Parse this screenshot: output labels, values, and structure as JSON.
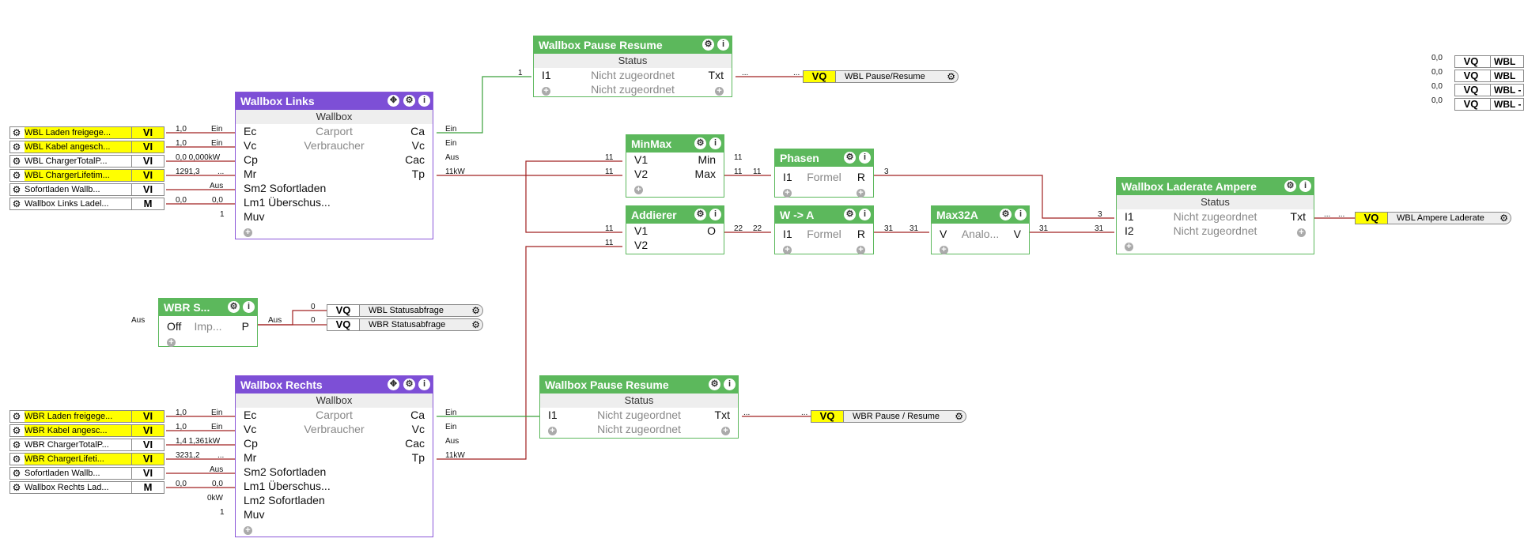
{
  "inputs_left_top": [
    {
      "name": "WBL Laden freigege...",
      "type": "VI",
      "hl": "all"
    },
    {
      "name": "WBL Kabel angesch...",
      "type": "VI",
      "hl": "all"
    },
    {
      "name": "WBL ChargerTotalP...",
      "type": "VI",
      "hl": "none"
    },
    {
      "name": "WBL ChargerLifetim...",
      "type": "VI",
      "hl": "all"
    },
    {
      "name": "Sofortladen Wallb...",
      "type": "VI",
      "hl": "none"
    },
    {
      "name": "Wallbox Links Ladel...",
      "type": "M",
      "hl": "part"
    }
  ],
  "inputs_left_bottom": [
    {
      "name": "WBR Laden freigege...",
      "type": "VI",
      "hl": "all"
    },
    {
      "name": "WBR Kabel angesc...",
      "type": "VI",
      "hl": "all"
    },
    {
      "name": "WBR ChargerTotalP...",
      "type": "VI",
      "hl": "none"
    },
    {
      "name": "WBR ChargerLifeti...",
      "type": "VI",
      "hl": "all"
    },
    {
      "name": "Sofortladen Wallb...",
      "type": "VI",
      "hl": "none"
    },
    {
      "name": "Wallbox Rechts Lad...",
      "type": "M",
      "hl": "part"
    }
  ],
  "wallbox_links": {
    "title": "Wallbox Links",
    "subtitle": "Wallbox",
    "rows": [
      {
        "l": "Ec",
        "c": "Carport",
        "r": "Ca"
      },
      {
        "l": "Vc",
        "c": "Verbraucher",
        "r": "Vc"
      },
      {
        "l": "Cp",
        "c": "",
        "r": "Cac"
      },
      {
        "l": "Mr",
        "c": "",
        "r": "Tp"
      },
      {
        "l": "Sm2 Sofortladen",
        "c": "",
        "r": ""
      },
      {
        "l": "Lm1 Überschus...",
        "c": "",
        "r": ""
      },
      {
        "l": "Muv",
        "c": "",
        "r": ""
      }
    ],
    "in_values": [
      "1,0",
      "1,0",
      "0,0 0,000kW",
      "1291,3",
      "Aus",
      "0,0",
      "1"
    ],
    "in_labels": [
      "Ein",
      "Ein",
      "",
      "...",
      "Aus",
      "0,0",
      ""
    ],
    "out_values": [
      "Ein",
      "Ein",
      "Aus",
      "11kW"
    ]
  },
  "wallbox_rechts": {
    "title": "Wallbox Rechts",
    "subtitle": "Wallbox",
    "rows": [
      {
        "l": "Ec",
        "c": "Carport",
        "r": "Ca"
      },
      {
        "l": "Vc",
        "c": "Verbraucher",
        "r": "Vc"
      },
      {
        "l": "Cp",
        "c": "",
        "r": "Cac"
      },
      {
        "l": "Mr",
        "c": "",
        "r": "Tp"
      },
      {
        "l": "Sm2 Sofortladen",
        "c": "",
        "r": ""
      },
      {
        "l": "Lm1 Überschus...",
        "c": "",
        "r": ""
      },
      {
        "l": "Lm2 Sofortladen",
        "c": "",
        "r": ""
      },
      {
        "l": "Muv",
        "c": "",
        "r": ""
      }
    ],
    "in_values": [
      "1,0",
      "1,0",
      "1,4 1,361kW",
      "3231,2",
      "Aus",
      "0,0",
      "0kW",
      "1"
    ],
    "in_labels": [
      "Ein",
      "Ein",
      "",
      "...",
      "Aus",
      "0,0",
      "",
      ""
    ],
    "out_values": [
      "Ein",
      "Ein",
      "Aus",
      "11kW"
    ]
  },
  "pause_top": {
    "title": "Wallbox Pause Resume",
    "subtitle": "Status",
    "rows": [
      {
        "l": "I1",
        "c": "Nicht zugeordnet",
        "r": "Txt"
      },
      {
        "l": "+",
        "c": "Nicht zugeordnet",
        "r": ""
      }
    ],
    "in": "1",
    "out": "..."
  },
  "pause_bottom": {
    "title": "Wallbox Pause Resume",
    "subtitle": "Status",
    "rows": [
      {
        "l": "I1",
        "c": "Nicht zugeordnet",
        "r": "Txt"
      },
      {
        "l": "+",
        "c": "Nicht zugeordnet",
        "r": ""
      }
    ],
    "out": "..."
  },
  "minmax": {
    "title": "MinMax",
    "rows": [
      {
        "l": "V1",
        "r": "Min"
      },
      {
        "l": "V2",
        "r": "Max"
      }
    ],
    "in": [
      "11",
      "11"
    ],
    "out": [
      "11",
      "11"
    ]
  },
  "addierer": {
    "title": "Addierer",
    "rows": [
      {
        "l": "V1",
        "r": "O"
      },
      {
        "l": "V2",
        "r": ""
      }
    ],
    "in": [
      "11",
      "11"
    ],
    "out": "22"
  },
  "phasen": {
    "title": "Phasen",
    "rows": [
      {
        "l": "I1",
        "c": "Formel",
        "r": "R"
      }
    ],
    "in": "11",
    "out": "3"
  },
  "w2a": {
    "title": "W -> A",
    "rows": [
      {
        "l": "I1",
        "c": "Formel",
        "r": "R"
      }
    ],
    "in": "22",
    "out": "31"
  },
  "max32a": {
    "title": "Max32A",
    "rows": [
      {
        "l": "V",
        "c": "Analo...",
        "r": "V"
      }
    ],
    "in": "31",
    "out": "31"
  },
  "laderate": {
    "title": "Wallbox Laderate Ampere",
    "subtitle": "Status",
    "rows": [
      {
        "l": "I1",
        "c": "Nicht zugeordnet",
        "r": "Txt"
      },
      {
        "l": "I2",
        "c": "Nicht zugeordnet",
        "r": ""
      }
    ],
    "in": [
      "3",
      "31"
    ],
    "out": "..."
  },
  "wbr_s": {
    "title": "WBR S...",
    "rows": [
      {
        "l": "Off",
        "c": "Imp...",
        "r": "P"
      }
    ],
    "in": "Aus",
    "out": "Aus"
  },
  "outputs": {
    "wbl_pause": {
      "type": "VQ",
      "name": "WBL Pause/Resume",
      "val": "..."
    },
    "wbr_pause": {
      "type": "VQ",
      "name": "WBR Pause / Resume",
      "val": "..."
    },
    "wbl_ampere": {
      "type": "VQ",
      "name": "WBL Ampere Laderate",
      "val": "..."
    },
    "wbl_status": {
      "type": "VQ",
      "name": "WBL Statusabfrage",
      "val": "0"
    },
    "wbr_status": {
      "type": "VQ",
      "name": "WBR Statusabfrage",
      "val": "0"
    }
  },
  "right_outputs": [
    {
      "val": "0,0",
      "type": "VQ",
      "name": "WBL"
    },
    {
      "val": "0,0",
      "type": "VQ",
      "name": "WBL"
    },
    {
      "val": "0,0",
      "type": "VQ",
      "name": "WBL -"
    },
    {
      "val": "0,0",
      "type": "VQ",
      "name": "WBL -"
    }
  ],
  "icons": {
    "gear": "gear-icon",
    "info": "info-icon",
    "move": "move-icon",
    "plus": "plus-icon",
    "lamp": "lamp-icon"
  },
  "colors": {
    "green": "#5cb85c",
    "purple": "#7d4fd6",
    "wire_red": "#a02020",
    "wire_green": "#3aa03a",
    "highlight": "#ffff00"
  }
}
